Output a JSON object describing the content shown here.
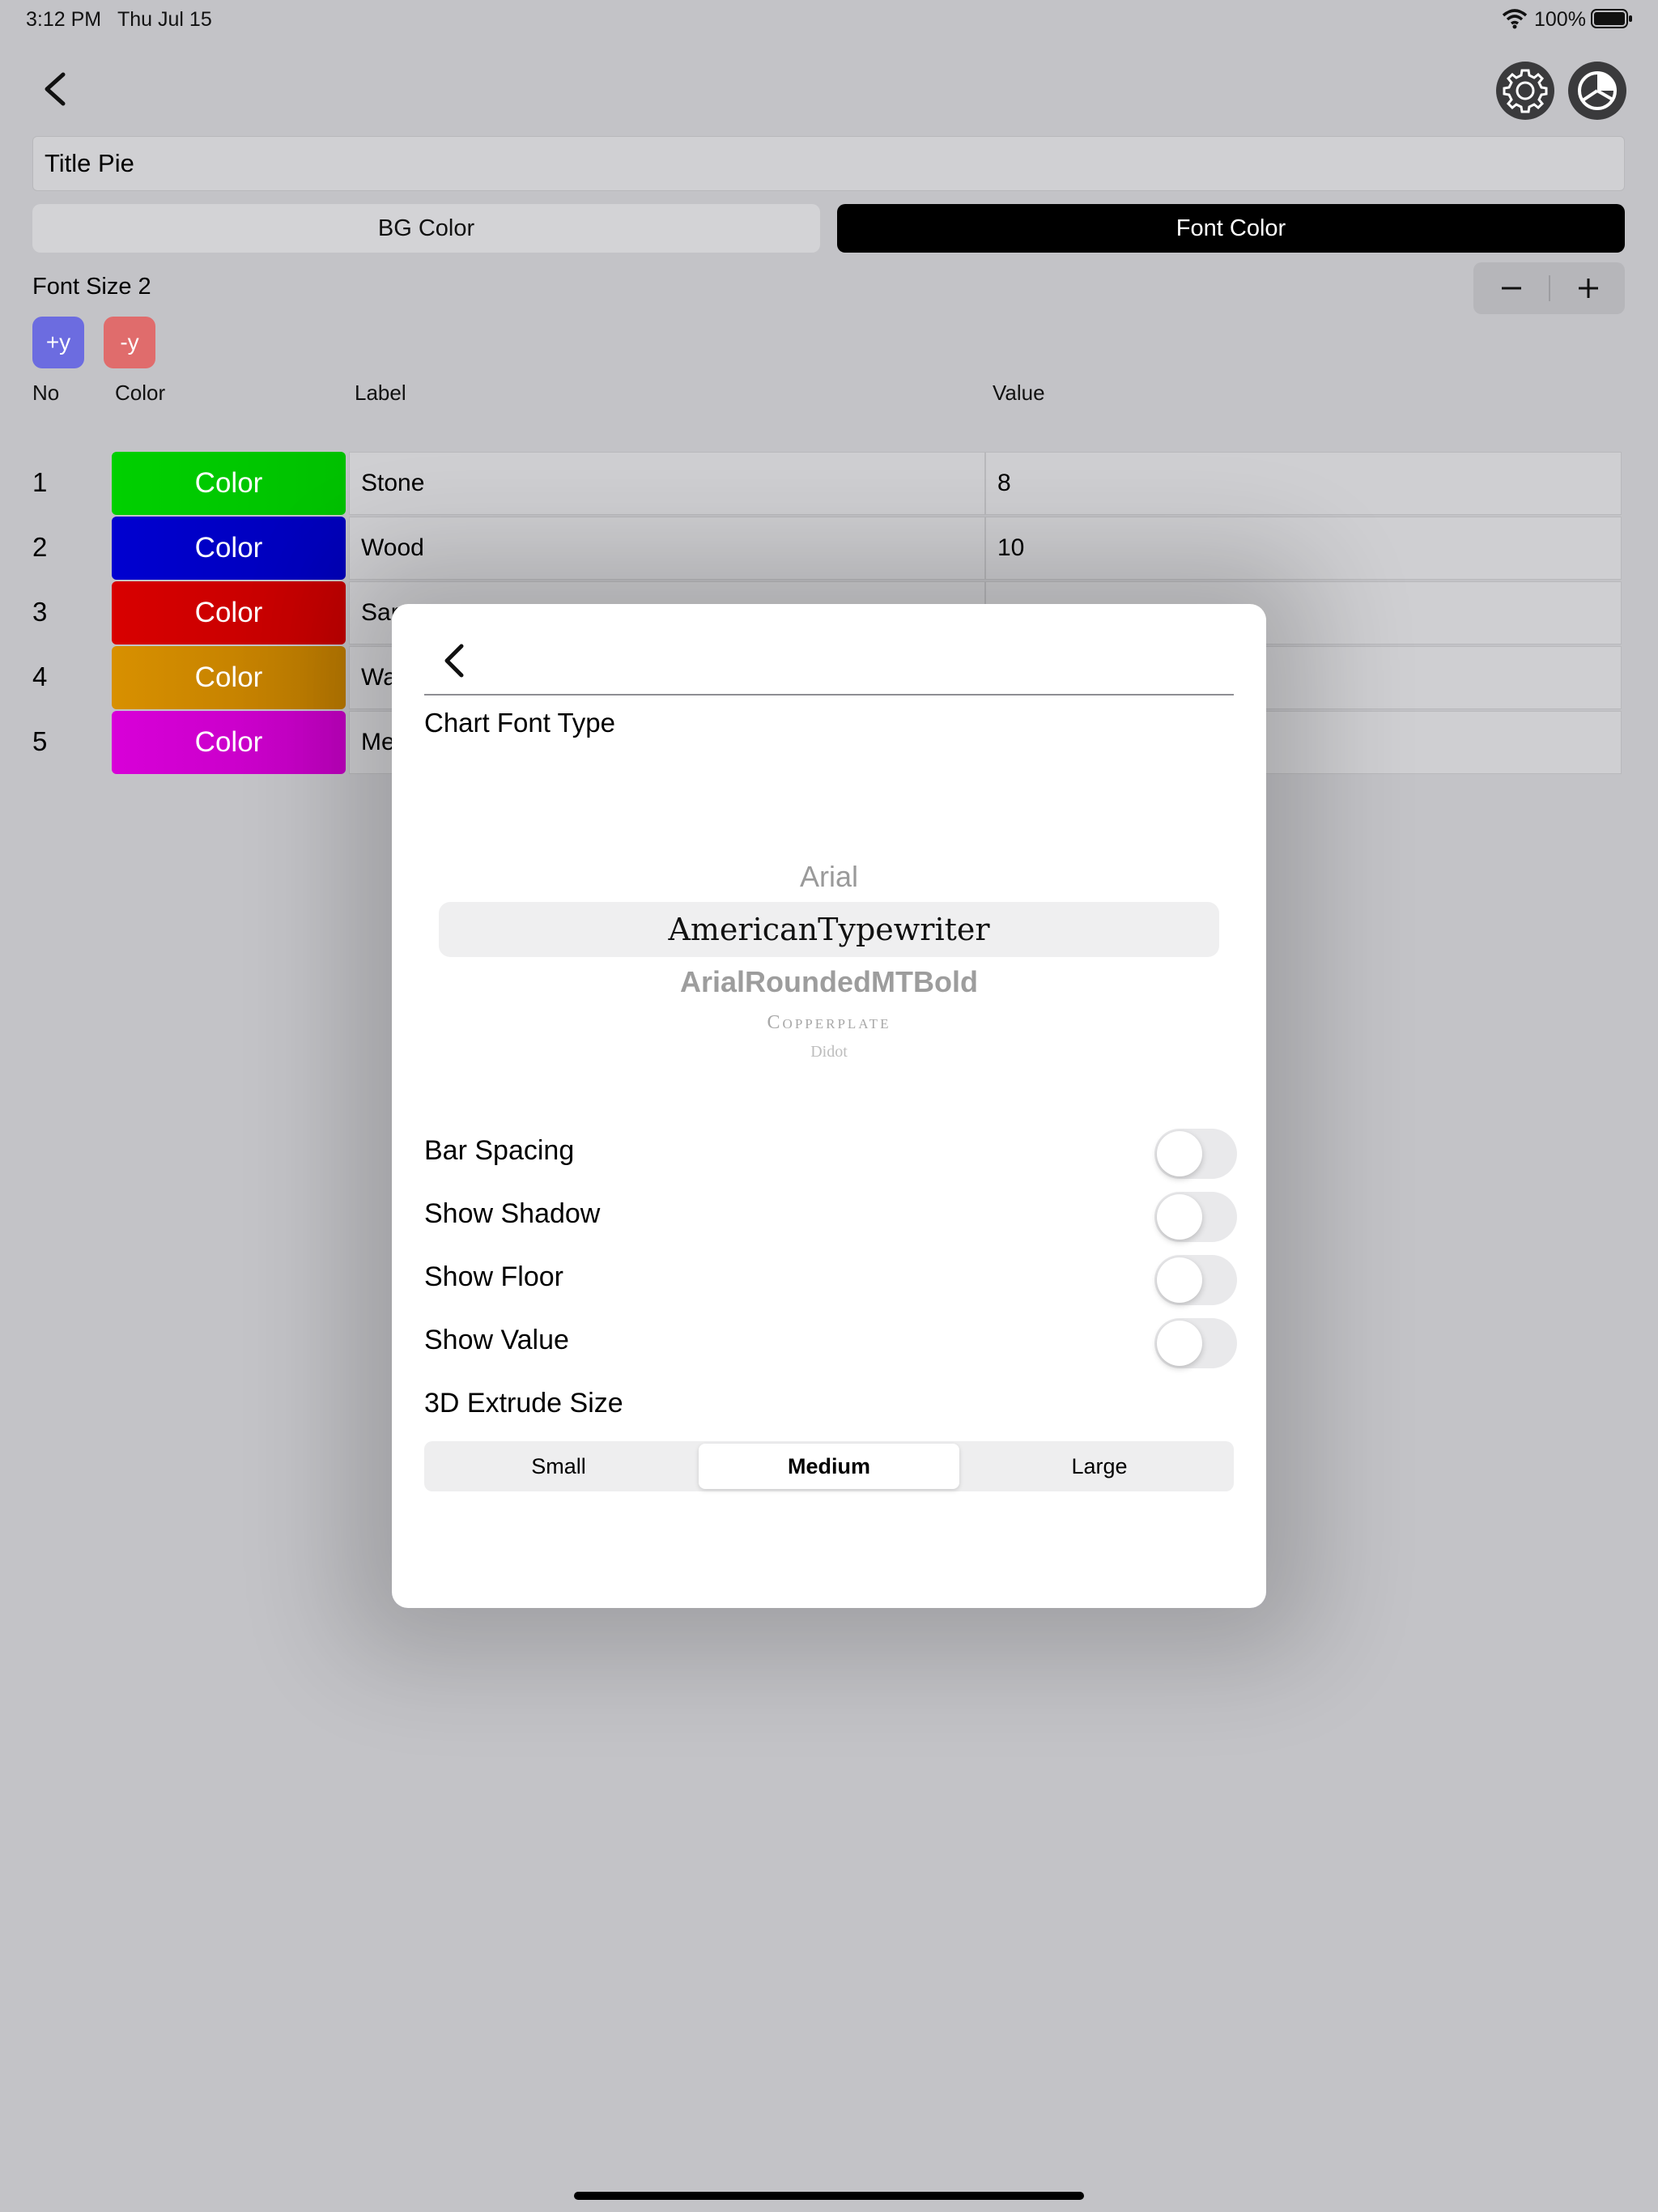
{
  "status_bar": {
    "time": "3:12 PM",
    "date": "Thu Jul 15",
    "battery": "100%"
  },
  "header": {
    "title_value": "Title Pie"
  },
  "tabs": {
    "bg_color": "BG Color",
    "font_color": "Font Color"
  },
  "font_size": {
    "label": "Font Size 2"
  },
  "y_buttons": {
    "plus": "+y",
    "minus": "-y"
  },
  "table": {
    "headers": {
      "no": "No",
      "color": "Color",
      "label": "Label",
      "value": "Value"
    },
    "rows": [
      {
        "no": "1",
        "color_label": "Color",
        "color": "#00cc00",
        "label": "Stone",
        "value": "8"
      },
      {
        "no": "2",
        "color_label": "Color",
        "color": "#0000cc",
        "label": "Wood",
        "value": "10"
      },
      {
        "no": "3",
        "color_label": "Color",
        "color": "#cc0000",
        "label": "Sar",
        "value": ""
      },
      {
        "no": "4",
        "color_label": "Color",
        "color": "#cc8800",
        "label": "Wa",
        "value": ""
      },
      {
        "no": "5",
        "color_label": "Color",
        "color": "#cc00cc",
        "label": "Me",
        "value": ""
      }
    ]
  },
  "modal": {
    "heading": "Chart Font Type",
    "picker": {
      "items": [
        "Arial",
        "AmericanTypewriter",
        "ArialRoundedMTBold",
        "Copperplate",
        "Didot"
      ],
      "selected": "AmericanTypewriter"
    },
    "settings": {
      "bar_spacing": "Bar Spacing",
      "show_shadow": "Show Shadow",
      "show_floor": "Show Floor",
      "show_value": "Show Value"
    },
    "extrude": {
      "label": "3D Extrude Size",
      "options": [
        "Small",
        "Medium",
        "Large"
      ],
      "selected": "Medium"
    }
  },
  "colors": {
    "background": "#c3c3c7",
    "accent_plus": "#6c6ce0",
    "accent_minus": "#e06c6c"
  }
}
